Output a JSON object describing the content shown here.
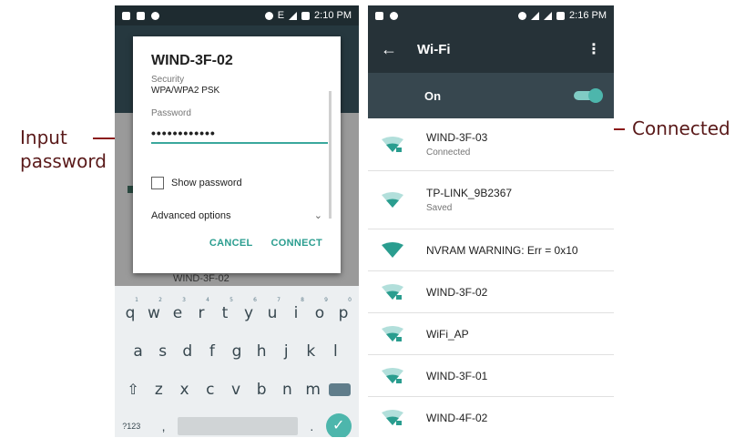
{
  "annotations": {
    "input_password": "Input\npassword",
    "connected": "Connected"
  },
  "left_phone": {
    "status_time": "2:10 PM",
    "network": "E",
    "dialog": {
      "title": "WIND-3F-02",
      "security_label": "Security",
      "security_value": "WPA/WPA2 PSK",
      "password_label": "Password",
      "password_value": "••••••••••••",
      "show_password_label": "Show password",
      "advanced_options_label": "Advanced options",
      "cancel_label": "CANCEL",
      "connect_label": "CONNECT"
    },
    "peek_network": "WIND-3F-02",
    "keyboard": {
      "row1": [
        "q",
        "w",
        "e",
        "r",
        "t",
        "y",
        "u",
        "i",
        "o",
        "p"
      ],
      "row1_hints": [
        "1",
        "2",
        "3",
        "4",
        "5",
        "6",
        "7",
        "8",
        "9",
        "0"
      ],
      "row2": [
        "a",
        "s",
        "d",
        "f",
        "g",
        "h",
        "j",
        "k",
        "l"
      ],
      "row3": [
        "z",
        "x",
        "c",
        "v",
        "b",
        "n",
        "m"
      ],
      "symbols_key": "?123",
      "comma_key": ",",
      "period_key": "."
    }
  },
  "right_phone": {
    "status_time": "2:16 PM",
    "title": "Wi-Fi",
    "toggle_label": "On",
    "toggle_on": true,
    "accent_color": "#2a9d8f",
    "networks": [
      {
        "name": "WIND-3F-03",
        "status": "Connected",
        "icon": "wifi-lock-icon"
      },
      {
        "name": "TP-LINK_9B2367",
        "status": "Saved",
        "icon": "wifi-icon"
      },
      {
        "name": "NVRAM WARNING: Err = 0x10",
        "status": "",
        "icon": "wifi-full-icon"
      },
      {
        "name": "WIND-3F-02",
        "status": "",
        "icon": "wifi-lock-icon"
      },
      {
        "name": "WiFi_AP",
        "status": "",
        "icon": "wifi-lock-icon"
      },
      {
        "name": "WIND-3F-01",
        "status": "",
        "icon": "wifi-lock-icon"
      },
      {
        "name": "WIND-4F-02",
        "status": "",
        "icon": "wifi-lock-icon"
      }
    ]
  }
}
